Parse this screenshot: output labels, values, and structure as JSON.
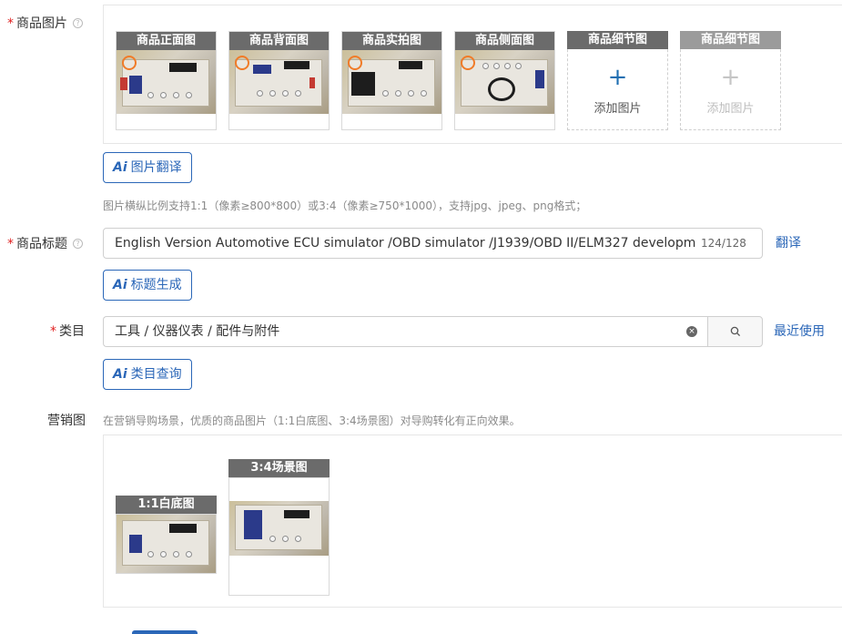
{
  "product_images": {
    "label": "商品图片",
    "slots": [
      {
        "title": "商品正面图"
      },
      {
        "title": "商品背面图"
      },
      {
        "title": "商品实拍图"
      },
      {
        "title": "商品侧面图"
      },
      {
        "title": "商品细节图",
        "add_text": "添加图片"
      },
      {
        "title": "商品细节图",
        "add_text": "添加图片"
      }
    ],
    "ai_button": "图片翻译",
    "hint": "图片横纵比例支持1:1（像素≥800*800）或3:4（像素≥750*1000），支持jpg、jpeg、png格式；"
  },
  "product_title": {
    "label": "商品标题",
    "value": "English Version Automotive ECU simulator /OBD simulator /J1939/OBD II/ELM327 developm",
    "counter": "124/128",
    "translate_link": "翻译",
    "ai_button": "标题生成"
  },
  "category": {
    "label": "类目",
    "value": "工具 / 仪器仪表 / 配件与附件",
    "recent_link": "最近使用",
    "ai_button": "类目查询"
  },
  "marketing": {
    "label": "营销图",
    "hint": "在营销导购场景，优质的商品图片（1:1白底图、3:4场景图）对导购转化有正向效果。",
    "slots": [
      {
        "title": "1:1白底图"
      },
      {
        "title": "3:4场景图"
      }
    ]
  },
  "icons": {
    "help": "question-circle-icon",
    "ai": "ai-icon",
    "clear": "clear-circle-icon",
    "search": "search-icon",
    "plus": "plus-icon"
  },
  "colors": {
    "accent": "#2b67b8",
    "required": "#e02020"
  }
}
